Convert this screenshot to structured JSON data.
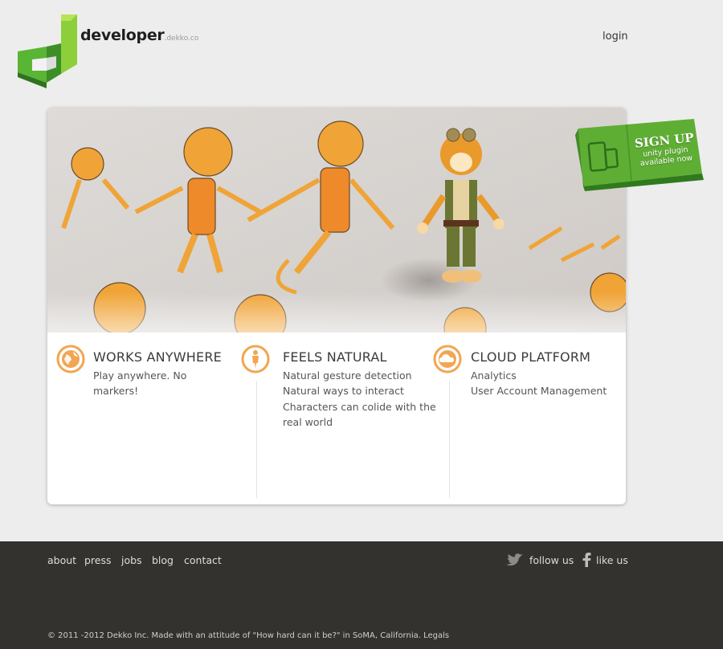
{
  "header": {
    "brand": "developer",
    "brand_suffix": ".dekko.co",
    "login": "login"
  },
  "signup": {
    "title": "SIGN UP",
    "line1": "unity plugin",
    "line2": "available now"
  },
  "features": [
    {
      "icon": "globe-icon",
      "title": "WORKS ANYWHERE",
      "lines": [
        "Play anywhere. No",
        "markers!"
      ]
    },
    {
      "icon": "person-icon",
      "title": "FEELS NATURAL",
      "lines": [
        "Natural gesture detection",
        "Natural ways to interact",
        "Characters can colide with the",
        "real world"
      ]
    },
    {
      "icon": "cloud-icon",
      "title": "CLOUD PLATFORM",
      "lines": [
        "Analytics",
        "User Account Management"
      ]
    }
  ],
  "footer": {
    "nav": [
      "about",
      "press",
      "jobs",
      "blog",
      "contact"
    ],
    "follow_us": "follow us",
    "like_us": "like us",
    "copyright": "© 2011 -2012 Dekko Inc. Made with an attitude of \"How hard can it be?\" in SoMA, California. Legals"
  },
  "colors": {
    "accent_orange": "#f2a552",
    "brand_green": "#6cc13d",
    "footer_bg": "#34322f",
    "page_bg": "#ededed"
  }
}
